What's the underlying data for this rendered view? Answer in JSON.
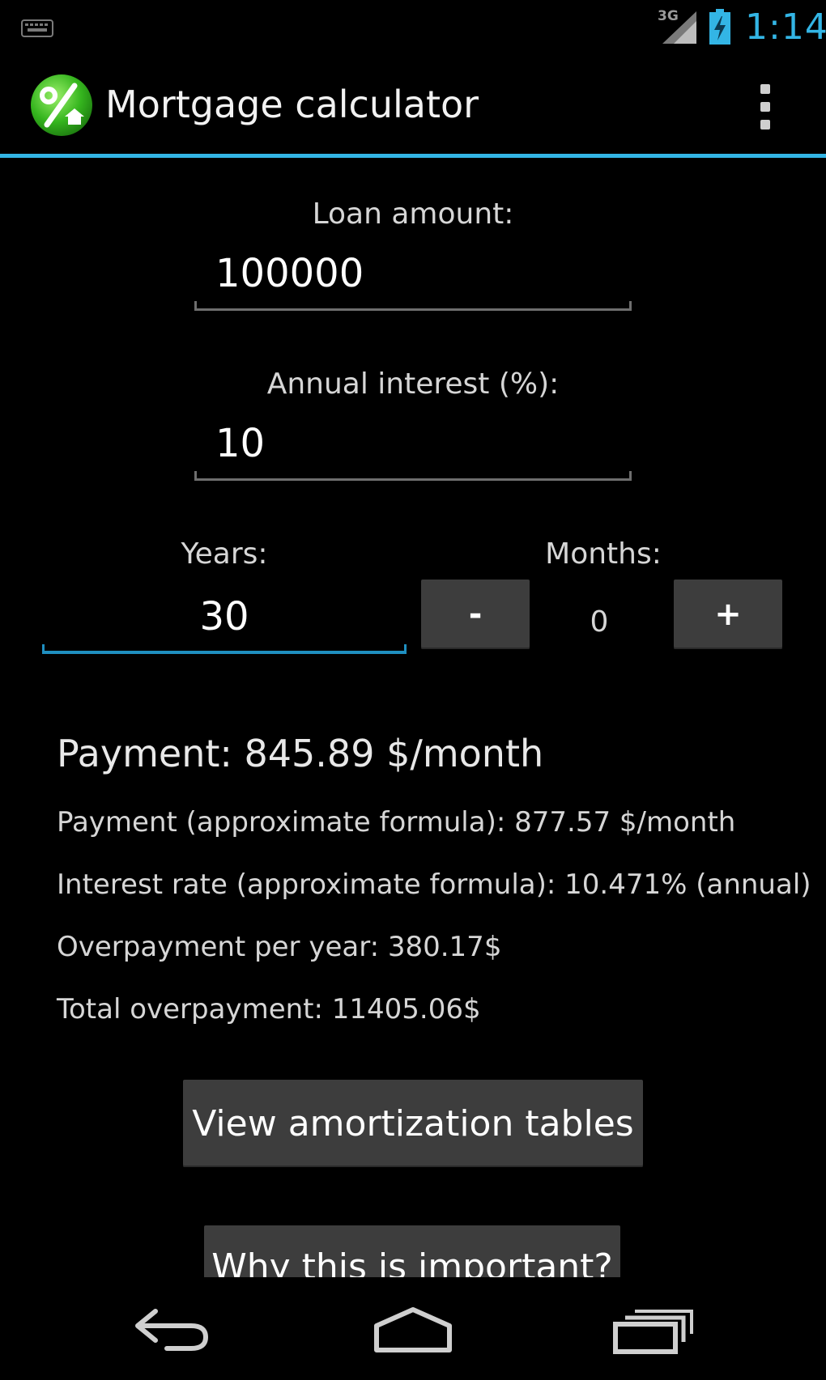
{
  "status_bar": {
    "network": "3G",
    "time": "1:14",
    "icons": [
      "keyboard-icon",
      "signal-icon",
      "battery-charging-icon"
    ],
    "accent": "#33b5e5"
  },
  "action_bar": {
    "title": "Mortgage calculator",
    "app_icon": "percent-house-icon",
    "menu_icon": "overflow-menu-icon"
  },
  "form": {
    "loan_label": "Loan amount:",
    "loan_value": "100000",
    "interest_label": "Annual interest (%):",
    "interest_value": "10",
    "years_label": "Years:",
    "years_value": "30",
    "months_label": "Months:",
    "months_value": "0",
    "minus_label": "-",
    "plus_label": "+"
  },
  "results": {
    "payment": "Payment: 845.89 $/month",
    "payment_approx": "Payment (approximate formula): 877.57 $/month",
    "interest_approx": "Interest rate (approximate formula): 10.471% (annual)",
    "overpayment_year": "Overpayment per year: 380.17$",
    "overpayment_total": "Total overpayment: 11405.06$"
  },
  "buttons": {
    "amortization": "View amortization tables",
    "why": "Why this is important?"
  },
  "nav_bar": {
    "icons": [
      "back-icon",
      "home-icon",
      "recent-apps-icon"
    ]
  }
}
